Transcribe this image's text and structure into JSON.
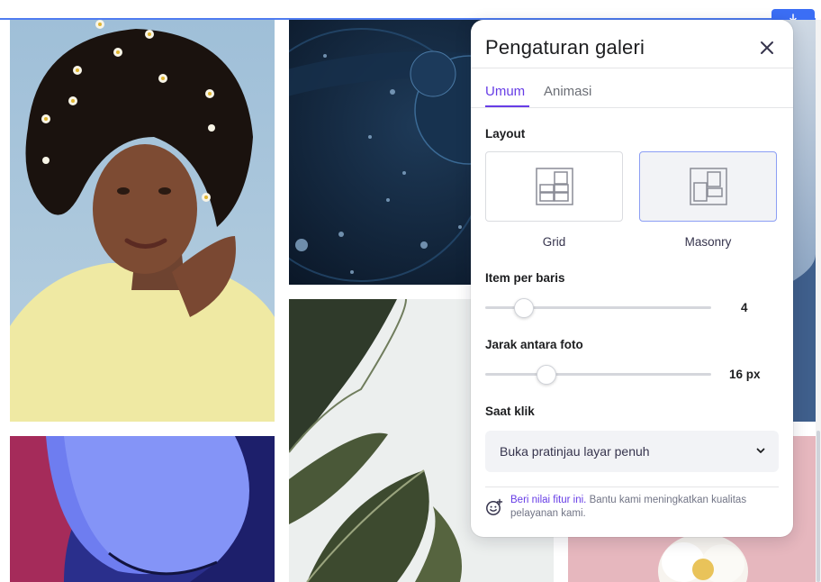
{
  "colors": {
    "accent": "#673de6",
    "download_button": "#3b6ef5",
    "selection_line": "#4f7cf0",
    "selected_card_border": "#8c9ef4"
  },
  "gallery": {
    "photos": [
      {
        "name": "woman-with-flowers-photo"
      },
      {
        "name": "water-bubbles-photo"
      },
      {
        "name": "blue-abstract-photo"
      },
      {
        "name": "tropical-leaf-photo"
      },
      {
        "name": "partial-blue-photo"
      },
      {
        "name": "pink-flower-photo"
      }
    ],
    "download_icon": "download-icon"
  },
  "panel": {
    "title": "Pengaturan galeri",
    "close_icon": "close-icon",
    "tabs": [
      {
        "label": "Umum",
        "active": true
      },
      {
        "label": "Animasi",
        "active": false
      }
    ],
    "layout": {
      "label": "Layout",
      "options": [
        {
          "label": "Grid",
          "icon": "grid-layout-icon",
          "selected": false
        },
        {
          "label": "Masonry",
          "icon": "masonry-layout-icon",
          "selected": true
        }
      ]
    },
    "items_per_row": {
      "label": "Item per baris",
      "value": "4",
      "level": 0.17
    },
    "photo_spacing": {
      "label": "Jarak antara foto",
      "value": "16 px",
      "level": 0.27
    },
    "on_click": {
      "label": "Saat klik",
      "selected": "Buka pratinjau layar penuh",
      "icon": "chevron-down-icon"
    },
    "feedback": {
      "link": "Beri nilai fitur ini.",
      "text": " Bantu kami meningkatkan kualitas pelayanan kami.",
      "icon": "smiley-plus-icon"
    }
  }
}
